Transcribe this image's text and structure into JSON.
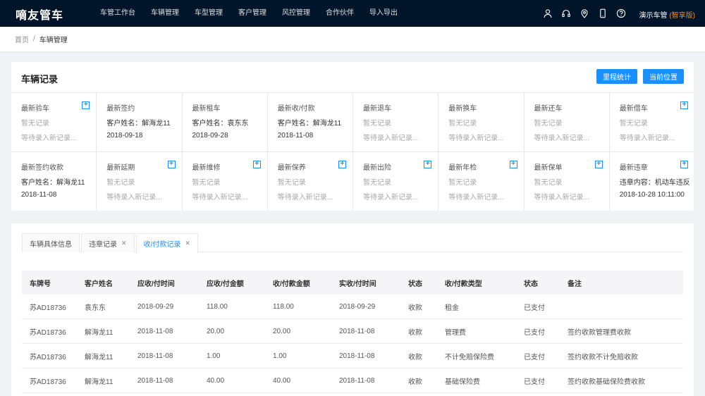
{
  "app": {
    "title": "嘀友管车",
    "user": "演示车管",
    "version": "(智享版)"
  },
  "nav": [
    "车管工作台",
    "车辆管理",
    "车型管理",
    "客户管理",
    "风控管理",
    "合作伙伴",
    "导入导出"
  ],
  "breadcrumb": {
    "home": "首页",
    "sep": "/",
    "current": "车辆管理"
  },
  "records": {
    "title": "车辆记录",
    "buttons": {
      "mileage": "里程统计",
      "location": "当前位置"
    },
    "rows": [
      [
        {
          "title": "最新验车",
          "l1": "暂无记录",
          "l2": "等待录入新记录...",
          "empty": true,
          "plus": true
        },
        {
          "title": "最新签约",
          "l1": "客户姓名：解海龙11",
          "l2": "2018-09-18",
          "empty": false,
          "plus": false
        },
        {
          "title": "最新租车",
          "l1": "客户姓名：袁东东",
          "l2": "2018-09-28",
          "empty": false,
          "plus": false
        },
        {
          "title": "最新收/付款",
          "l1": "客户姓名：解海龙11",
          "l2": "2018-11-08",
          "empty": false,
          "plus": false
        },
        {
          "title": "最新退车",
          "l1": "暂无记录",
          "l2": "等待录入新记录...",
          "empty": true,
          "plus": false
        },
        {
          "title": "最新换车",
          "l1": "暂无记录",
          "l2": "等待录入新记录...",
          "empty": true,
          "plus": false
        },
        {
          "title": "最新还车",
          "l1": "暂无记录",
          "l2": "等待录入新记录...",
          "empty": true,
          "plus": false
        },
        {
          "title": "最新借车",
          "l1": "暂无记录",
          "l2": "等待录入新记录...",
          "empty": true,
          "plus": true
        }
      ],
      [
        {
          "title": "最新签约收款",
          "l1": "客户姓名：解海龙11",
          "l2": "2018-11-08",
          "empty": false,
          "plus": false
        },
        {
          "title": "最新延期",
          "l1": "暂无记录",
          "l2": "等待录入新记录...",
          "empty": true,
          "plus": true
        },
        {
          "title": "最新维修",
          "l1": "暂无记录",
          "l2": "等待录入新记录...",
          "empty": true,
          "plus": true
        },
        {
          "title": "最新保养",
          "l1": "暂无记录",
          "l2": "等待录入新记录...",
          "empty": true,
          "plus": true
        },
        {
          "title": "最新出险",
          "l1": "暂无记录",
          "l2": "等待录入新记录...",
          "empty": true,
          "plus": true
        },
        {
          "title": "最新年检",
          "l1": "暂无记录",
          "l2": "等待录入新记录...",
          "empty": true,
          "plus": true
        },
        {
          "title": "最新保单",
          "l1": "暂无记录",
          "l2": "等待录入新记录...",
          "empty": true,
          "plus": true
        },
        {
          "title": "最新违章",
          "l1": "违章内容：机动车违反",
          "l2": "2018-10-28 10:11:00",
          "empty": false,
          "plus": true
        }
      ]
    ]
  },
  "tabs": [
    {
      "label": "车辆具体信息",
      "closable": false,
      "active": false
    },
    {
      "label": "违章记录",
      "closable": true,
      "active": false
    },
    {
      "label": "收/付款记录",
      "closable": true,
      "active": true
    }
  ],
  "table": {
    "headers": [
      "车牌号",
      "客户姓名",
      "应收/付时间",
      "应收/付金额",
      "收/付款金额",
      "实收/付时间",
      "状态",
      "收/付款类型",
      "状态",
      "备注"
    ],
    "rows": [
      [
        "苏AD18736",
        "袁东东",
        "2018-09-29",
        "118.00",
        "118.00",
        "2018-09-29",
        "收款",
        "租金",
        "已支付",
        ""
      ],
      [
        "苏AD18736",
        "解海龙11",
        "2018-11-08",
        "20.00",
        "20.00",
        "2018-11-08",
        "收款",
        "管理费",
        "已支付",
        "签约收款管理费收款"
      ],
      [
        "苏AD18736",
        "解海龙11",
        "2018-11-08",
        "1.00",
        "1.00",
        "2018-11-08",
        "收款",
        "不计免赔保险费",
        "已支付",
        "签约收款不计免赔收款"
      ],
      [
        "苏AD18736",
        "解海龙11",
        "2018-11-08",
        "40.00",
        "40.00",
        "2018-11-08",
        "收款",
        "基础保险费",
        "已支付",
        "签约收款基础保险费收款"
      ]
    ]
  },
  "icons": [
    "user-icon",
    "headset-icon",
    "location-pin-icon",
    "phone-icon",
    "help-icon",
    "plus-icon",
    "close-icon"
  ],
  "colors": {
    "topbar": "#001529",
    "accent": "#1890ff",
    "version": "#fa8c16"
  }
}
